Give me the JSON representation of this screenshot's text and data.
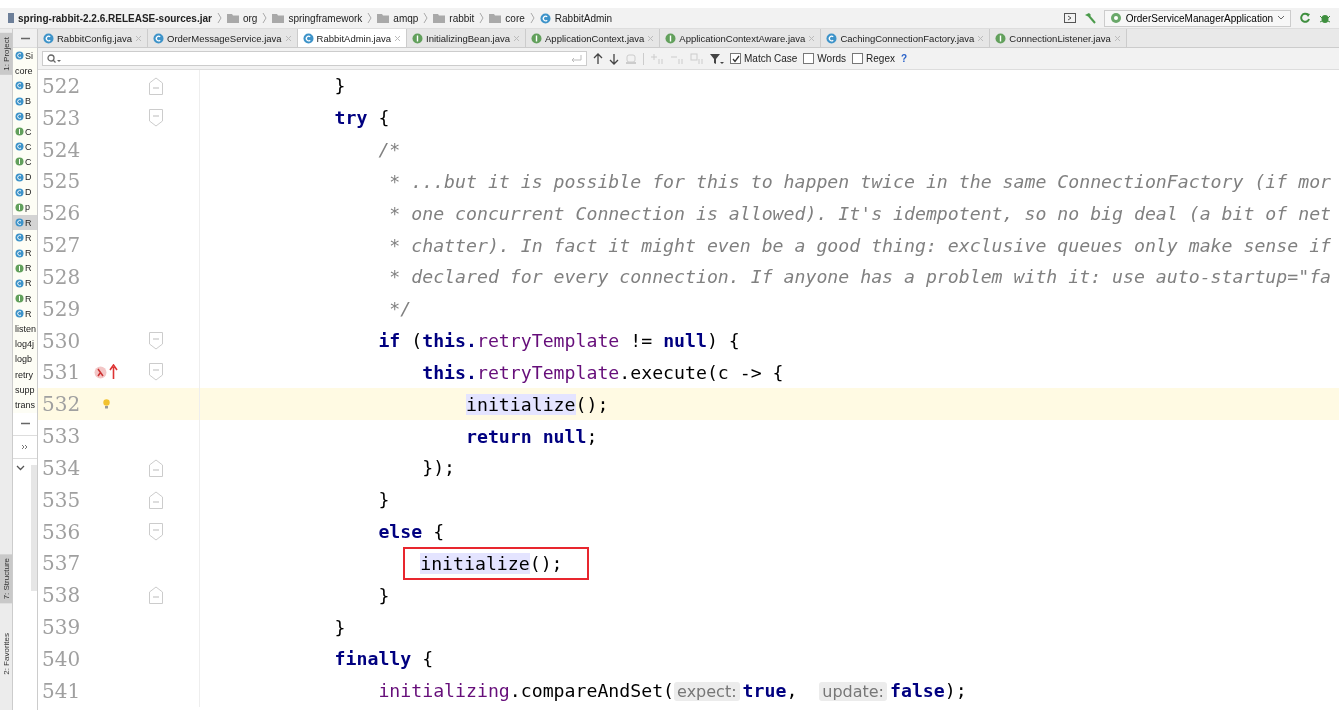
{
  "breadcrumbs": [
    {
      "label": "spring-rabbit-2.2.6.RELEASE-sources.jar",
      "kind": "jar"
    },
    {
      "label": "org",
      "kind": "folder"
    },
    {
      "label": "springframework",
      "kind": "folder"
    },
    {
      "label": "amqp",
      "kind": "folder"
    },
    {
      "label": "rabbit",
      "kind": "folder"
    },
    {
      "label": "core",
      "kind": "folder"
    },
    {
      "label": "RabbitAdmin",
      "kind": "class"
    }
  ],
  "run_config": {
    "label": "OrderServiceManagerApplication"
  },
  "tool_windows": [
    {
      "label": "1: Project",
      "selected": true
    },
    {
      "label": "7: Structure",
      "selected": true
    },
    {
      "label": "2: Favorites",
      "selected": false
    }
  ],
  "project_items": [
    {
      "label": "Si",
      "kind": "class",
      "selected": false
    },
    {
      "label": "core",
      "kind": "folder",
      "selected": false
    },
    {
      "label": "B",
      "kind": "class",
      "selected": false
    },
    {
      "label": "B",
      "kind": "class",
      "selected": false
    },
    {
      "label": "B",
      "kind": "class",
      "selected": false
    },
    {
      "label": "C",
      "kind": "interface",
      "selected": false
    },
    {
      "label": "C",
      "kind": "class",
      "selected": false
    },
    {
      "label": "C",
      "kind": "interface",
      "selected": false
    },
    {
      "label": "D",
      "kind": "class",
      "selected": false
    },
    {
      "label": "D",
      "kind": "class",
      "selected": false
    },
    {
      "label": "p",
      "kind": "interface",
      "selected": false
    },
    {
      "label": "R",
      "kind": "class",
      "selected": true
    },
    {
      "label": "R",
      "kind": "class",
      "selected": false
    },
    {
      "label": "R",
      "kind": "class",
      "selected": false
    },
    {
      "label": "R",
      "kind": "interface",
      "selected": false
    },
    {
      "label": "R",
      "kind": "class",
      "selected": false
    },
    {
      "label": "R",
      "kind": "interface",
      "selected": false
    },
    {
      "label": "R",
      "kind": "class",
      "selected": false
    },
    {
      "label": "listen",
      "kind": "folder",
      "selected": false
    },
    {
      "label": "log4j",
      "kind": "folder",
      "selected": false
    },
    {
      "label": "logb",
      "kind": "folder",
      "selected": false
    },
    {
      "label": "retry",
      "kind": "folder",
      "selected": false
    },
    {
      "label": "supp",
      "kind": "folder",
      "selected": false
    },
    {
      "label": "trans",
      "kind": "folder",
      "selected": false
    }
  ],
  "tabs": [
    {
      "label": "RabbitConfig.java",
      "kind": "class",
      "selected": false
    },
    {
      "label": "OrderMessageService.java",
      "kind": "class",
      "selected": false
    },
    {
      "label": "RabbitAdmin.java",
      "kind": "class",
      "selected": true
    },
    {
      "label": "InitializingBean.java",
      "kind": "interface",
      "selected": false
    },
    {
      "label": "ApplicationContext.java",
      "kind": "interface",
      "selected": false
    },
    {
      "label": "ApplicationContextAware.java",
      "kind": "interface",
      "selected": false
    },
    {
      "label": "CachingConnectionFactory.java",
      "kind": "class",
      "selected": false
    },
    {
      "label": "ConnectionListener.java",
      "kind": "interface",
      "selected": false
    }
  ],
  "find_bar": {
    "options": [
      {
        "label": "Match Case",
        "checked": true
      },
      {
        "label": "Words",
        "checked": false
      },
      {
        "label": "Regex",
        "checked": false
      }
    ],
    "help": "?"
  },
  "code_lines": [
    {
      "number": "522",
      "current": false,
      "boxed": false,
      "fold_start": false,
      "fold_end": true,
      "tokens": [
        {
          "text": "        }",
          "kind": "plain"
        }
      ]
    },
    {
      "number": "523",
      "current": false,
      "boxed": false,
      "fold_start": true,
      "fold_end": false,
      "tokens": [
        {
          "text": "        try",
          "kind": "keyword"
        },
        {
          "text": " {",
          "kind": "plain"
        }
      ]
    },
    {
      "number": "524",
      "current": false,
      "boxed": false,
      "fold_start": false,
      "fold_end": false,
      "tokens": [
        {
          "text": "            /*",
          "kind": "comment"
        }
      ]
    },
    {
      "number": "525",
      "current": false,
      "boxed": false,
      "fold_start": false,
      "fold_end": false,
      "tokens": [
        {
          "text": "             * ...but it is possible for this to happen twice in the same ConnectionFactory (if mor",
          "kind": "comment"
        }
      ]
    },
    {
      "number": "526",
      "current": false,
      "boxed": false,
      "fold_start": false,
      "fold_end": false,
      "tokens": [
        {
          "text": "             * one concurrent Connection is allowed). It's idempotent, so no big deal (a bit of net",
          "kind": "comment"
        }
      ]
    },
    {
      "number": "527",
      "current": false,
      "boxed": false,
      "fold_start": false,
      "fold_end": false,
      "tokens": [
        {
          "text": "             * chatter). In fact it might even be a good thing: exclusive queues only make sense if",
          "kind": "comment"
        }
      ]
    },
    {
      "number": "528",
      "current": false,
      "boxed": false,
      "fold_start": false,
      "fold_end": false,
      "tokens": [
        {
          "text": "             * declared for every connection. If anyone has a problem with it: use auto-startup=\"fa",
          "kind": "comment"
        }
      ]
    },
    {
      "number": "529",
      "current": false,
      "boxed": false,
      "fold_start": false,
      "fold_end": false,
      "tokens": [
        {
          "text": "             */",
          "kind": "comment"
        }
      ]
    },
    {
      "number": "530",
      "current": false,
      "boxed": false,
      "fold_start": true,
      "fold_end": false,
      "tokens": [
        {
          "text": "            if",
          "kind": "keyword"
        },
        {
          "text": " (",
          "kind": "plain"
        },
        {
          "text": "this.",
          "kind": "keyword"
        },
        {
          "text": "retryTemplate",
          "kind": "field"
        },
        {
          "text": " != ",
          "kind": "plain"
        },
        {
          "text": "null",
          "kind": "keyword"
        },
        {
          "text": ") {",
          "kind": "plain"
        }
      ]
    },
    {
      "number": "531",
      "current": false,
      "boxed": false,
      "fold_start": true,
      "fold_end": false,
      "gutter_icons": [
        {
          "kind": "lambda"
        },
        {
          "kind": "override"
        }
      ],
      "tokens": [
        {
          "text": "                this.",
          "kind": "keyword"
        },
        {
          "text": "retryTemplate",
          "kind": "field"
        },
        {
          "text": ".execute(c -> {",
          "kind": "plain"
        }
      ]
    },
    {
      "number": "532",
      "current": true,
      "boxed": false,
      "fold_start": false,
      "fold_end": false,
      "gutter_icons": [
        {
          "kind": "bulb"
        }
      ],
      "tokens": [
        {
          "text": "                    initialize",
          "kind": "usage"
        },
        {
          "text": "();",
          "kind": "plain"
        }
      ]
    },
    {
      "number": "533",
      "current": false,
      "boxed": false,
      "fold_start": false,
      "fold_end": false,
      "tokens": [
        {
          "text": "                    return null",
          "kind": "keyword"
        },
        {
          "text": ";",
          "kind": "plain"
        }
      ]
    },
    {
      "number": "534",
      "current": false,
      "boxed": false,
      "fold_start": false,
      "fold_end": true,
      "tokens": [
        {
          "text": "                });",
          "kind": "plain"
        }
      ]
    },
    {
      "number": "535",
      "current": false,
      "boxed": false,
      "fold_start": false,
      "fold_end": true,
      "tokens": [
        {
          "text": "            }",
          "kind": "plain"
        }
      ]
    },
    {
      "number": "536",
      "current": false,
      "boxed": false,
      "fold_start": true,
      "fold_end": false,
      "tokens": [
        {
          "text": "            else",
          "kind": "keyword"
        },
        {
          "text": " {",
          "kind": "plain"
        }
      ]
    },
    {
      "number": "537",
      "current": false,
      "boxed": true,
      "fold_start": false,
      "fold_end": false,
      "tokens": [
        {
          "text": "                initialize",
          "kind": "usage"
        },
        {
          "text": "();",
          "kind": "plain"
        }
      ]
    },
    {
      "number": "538",
      "current": false,
      "boxed": false,
      "fold_start": false,
      "fold_end": true,
      "tokens": [
        {
          "text": "            }",
          "kind": "plain"
        }
      ]
    },
    {
      "number": "539",
      "current": false,
      "boxed": false,
      "fold_start": false,
      "fold_end": false,
      "tokens": [
        {
          "text": "        }",
          "kind": "plain"
        }
      ]
    },
    {
      "number": "540",
      "current": false,
      "boxed": false,
      "fold_start": false,
      "fold_end": false,
      "tokens": [
        {
          "text": "        finally",
          "kind": "keyword"
        },
        {
          "text": " {",
          "kind": "plain"
        }
      ]
    },
    {
      "number": "541",
      "current": false,
      "boxed": false,
      "fold_start": false,
      "fold_end": false,
      "tokens": [
        {
          "text": "            initializing",
          "kind": "field"
        },
        {
          "text": ".compareAndSet(",
          "kind": "plain"
        },
        {
          "text": "expect:",
          "kind": "hint"
        },
        {
          "text": "true",
          "kind": "keyword"
        },
        {
          "text": ",  ",
          "kind": "plain"
        },
        {
          "text": "update:",
          "kind": "hint"
        },
        {
          "text": "false",
          "kind": "keyword"
        },
        {
          "text": ");",
          "kind": "plain"
        }
      ]
    }
  ]
}
